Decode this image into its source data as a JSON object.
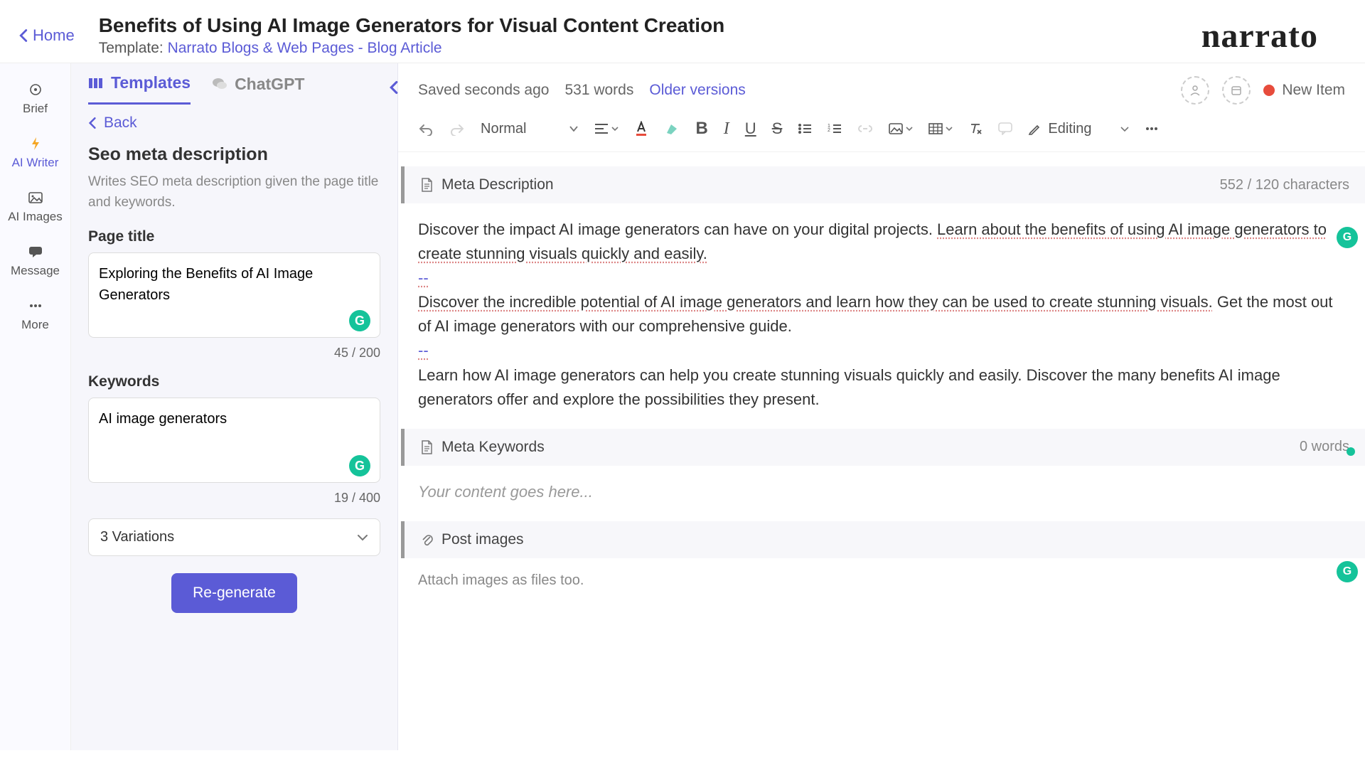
{
  "header": {
    "home": "Home",
    "title": "Benefits of Using AI Image Generators for Visual Content Creation",
    "template_label": "Template: ",
    "template_link": "Narrato Blogs & Web Pages - Blog Article",
    "logo": "narrato"
  },
  "leftbar": {
    "brief": "Brief",
    "ai_writer": "AI Writer",
    "ai_images": "AI Images",
    "message": "Message",
    "more": "More"
  },
  "panel": {
    "tab_templates": "Templates",
    "tab_chatgpt": "ChatGPT",
    "back": "Back",
    "heading": "Seo meta description",
    "desc": "Writes SEO meta description given the page title and keywords.",
    "page_title_label": "Page title",
    "page_title_value": "Exploring the Benefits of AI Image Generators",
    "page_title_count": "45 / 200",
    "keywords_label": "Keywords",
    "keywords_value": "AI image generators",
    "keywords_count": "19 / 400",
    "variations": "3 Variations",
    "regen": "Re-generate"
  },
  "editor": {
    "saved": "Saved seconds ago",
    "words": "531 words",
    "older": "Older versions",
    "status": "New Item",
    "para_style": "Normal",
    "editing_mode": "Editing"
  },
  "sections": {
    "meta_desc": {
      "title": "Meta Description",
      "count": "552 / 120 characters"
    },
    "meta_kw": {
      "title": "Meta Keywords",
      "count": "0 words"
    },
    "post_img": {
      "title": "Post images",
      "sub": "Attach images as files too."
    }
  },
  "content": {
    "p1a": "Discover the impact AI image generators can have on your digital projects. ",
    "p1b": "Learn about the benefits of using AI image generators to create stunning visuals quickly and easily.",
    "sep": "--",
    "p2a": "Discover the incredible potential of AI image generators and learn how they can be used to create stunning visuals.",
    "p2b": " Get the most out of AI image generators with our comprehensive guide.",
    "p3": "Learn how AI image generators can help you create stunning visuals quickly and easily. Discover the many benefits AI image generators offer and explore the possibilities they present.",
    "placeholder": "Your content goes here..."
  },
  "grammarly": "G"
}
